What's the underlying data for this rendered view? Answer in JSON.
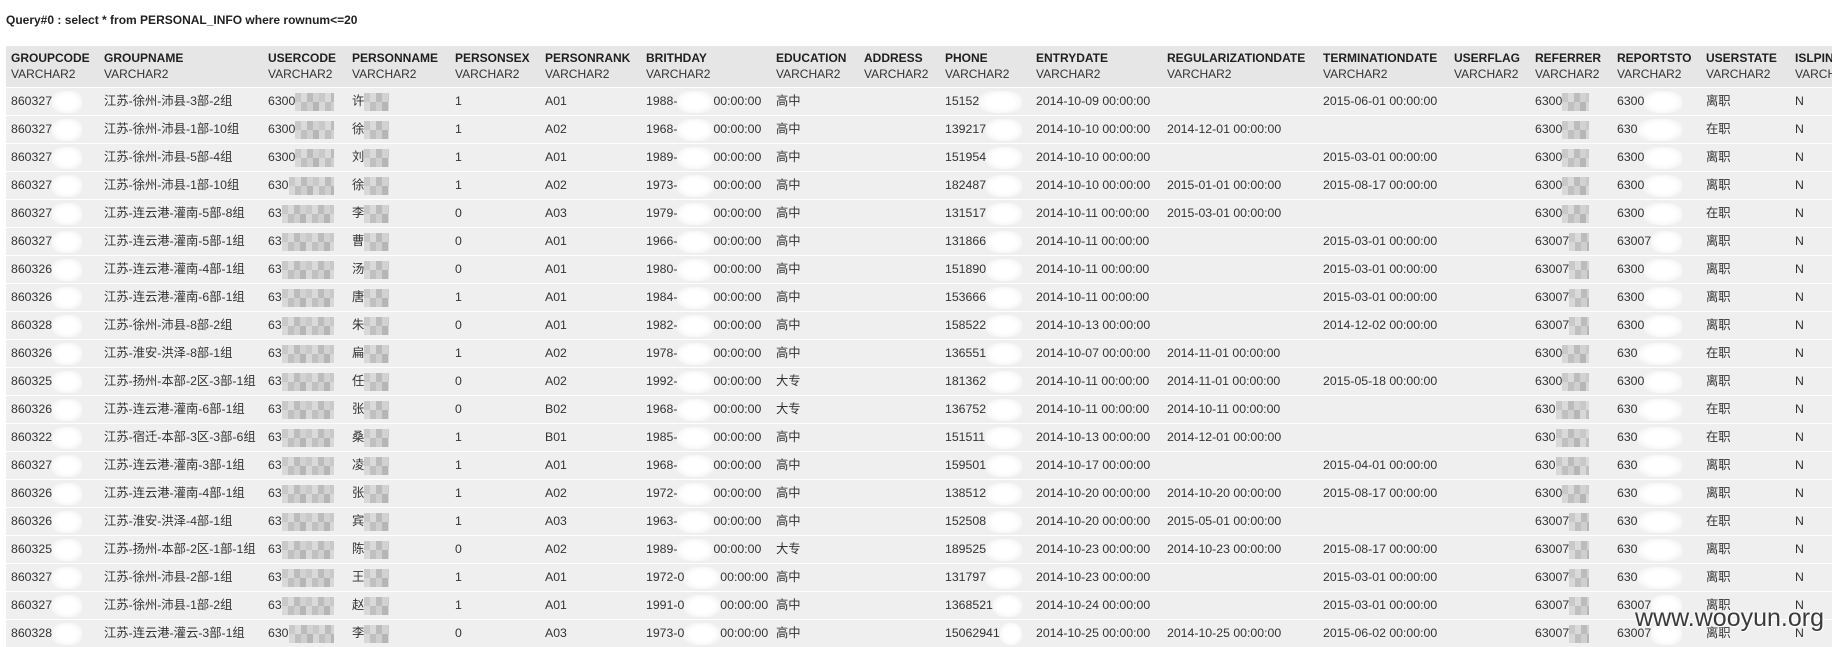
{
  "query": {
    "text": "Query#0 : select * from PERSONAL_INFO where rownum<=20"
  },
  "table": {
    "columns": [
      {
        "name": "GROUPCODE",
        "type": "VARCHAR2"
      },
      {
        "name": "GROUPNAME",
        "type": "VARCHAR2"
      },
      {
        "name": "USERCODE",
        "type": "VARCHAR2"
      },
      {
        "name": "PERSONNAME",
        "type": "VARCHAR2"
      },
      {
        "name": "PERSONSEX",
        "type": "VARCHAR2"
      },
      {
        "name": "PERSONRANK",
        "type": "VARCHAR2"
      },
      {
        "name": "BRITHDAY",
        "type": "VARCHAR2"
      },
      {
        "name": "EDUCATION",
        "type": "VARCHAR2"
      },
      {
        "name": "ADDRESS",
        "type": "VARCHAR2"
      },
      {
        "name": "PHONE",
        "type": "VARCHAR2"
      },
      {
        "name": "ENTRYDATE",
        "type": "VARCHAR2"
      },
      {
        "name": "REGULARIZATIONDATE",
        "type": "VARCHAR2"
      },
      {
        "name": "TERMINATIONDATE",
        "type": "VARCHAR2"
      },
      {
        "name": "USERFLAG",
        "type": "VARCHAR2"
      },
      {
        "name": "REFERRER",
        "type": "VARCHAR2"
      },
      {
        "name": "REPORTSTO",
        "type": "VARCHAR2"
      },
      {
        "name": "USERSTATE",
        "type": "VARCHAR2"
      },
      {
        "name": "ISLPIN",
        "type": "VARCHA"
      }
    ],
    "rows": [
      [
        "860327",
        "江苏-徐州-沛县-3部-2组",
        "6300",
        "许",
        "1",
        "A01",
        [
          "1988-",
          "00:00:00"
        ],
        "高中",
        "",
        "15152",
        "2014-10-09 00:00:00",
        "",
        "2015-06-01 00:00:00",
        "",
        "6300",
        "6300",
        "离职",
        "N"
      ],
      [
        "860327",
        "江苏-徐州-沛县-1部-10组",
        "6300",
        "徐",
        "1",
        "A02",
        [
          "1968-",
          "00:00:00"
        ],
        "高中",
        "",
        "139217",
        "2014-10-10 00:00:00",
        "2014-12-01 00:00:00",
        "",
        "",
        "6300",
        "630",
        "在职",
        "N"
      ],
      [
        "860327",
        "江苏-徐州-沛县-5部-4组",
        "6300",
        "刘",
        "1",
        "A01",
        [
          "1989-",
          "00:00:00"
        ],
        "高中",
        "",
        "151954",
        "2014-10-10 00:00:00",
        "",
        "2015-03-01 00:00:00",
        "",
        "6300",
        "6300",
        "离职",
        "N"
      ],
      [
        "860327",
        "江苏-徐州-沛县-1部-10组",
        "630",
        "徐",
        "1",
        "A02",
        [
          "1973-",
          "00:00:00"
        ],
        "高中",
        "",
        "182487",
        "2014-10-10 00:00:00",
        "2015-01-01 00:00:00",
        "2015-08-17 00:00:00",
        "",
        "6300",
        "6300",
        "离职",
        "N"
      ],
      [
        "860327",
        "江苏-连云港-灌南-5部-8组",
        "63",
        "李",
        "0",
        "A03",
        [
          "1979-",
          "00:00:00"
        ],
        "高中",
        "",
        "131517",
        "2014-10-11 00:00:00",
        "2015-03-01 00:00:00",
        "",
        "",
        "6300",
        "6300",
        "在职",
        "N"
      ],
      [
        "860327",
        "江苏-连云港-灌南-5部-1组",
        "63",
        "曹",
        "0",
        "A01",
        [
          "1966-",
          "00:00:00"
        ],
        "高中",
        "",
        "131866",
        "2014-10-11 00:00:00",
        "",
        "2015-03-01 00:00:00",
        "",
        "63007",
        "63007",
        "离职",
        "N"
      ],
      [
        "860326",
        "江苏-连云港-灌南-4部-1组",
        "63",
        "汤",
        "0",
        "A01",
        [
          "1980-",
          "00:00:00"
        ],
        "高中",
        "",
        "151890",
        "2014-10-11 00:00:00",
        "",
        "2015-03-01 00:00:00",
        "",
        "63007",
        "6300",
        "离职",
        "N"
      ],
      [
        "860326",
        "江苏-连云港-灌南-6部-1组",
        "63",
        "唐",
        "1",
        "A01",
        [
          "1984-",
          "00:00:00"
        ],
        "高中",
        "",
        "153666",
        "2014-10-11 00:00:00",
        "",
        "2015-03-01 00:00:00",
        "",
        "63007",
        "6300",
        "离职",
        "N"
      ],
      [
        "860328",
        "江苏-徐州-沛县-8部-2组",
        "63",
        "朱",
        "0",
        "A01",
        [
          "1982-",
          "00:00:00"
        ],
        "高中",
        "",
        "158522",
        "2014-10-13 00:00:00",
        "",
        "2014-12-02 00:00:00",
        "",
        "63007",
        "6300",
        "离职",
        "N"
      ],
      [
        "860326",
        "江苏-淮安-洪泽-8部-1组",
        "63",
        "扁",
        "1",
        "A02",
        [
          "1978-",
          "00:00:00"
        ],
        "高中",
        "",
        "136551",
        "2014-10-07 00:00:00",
        "2014-11-01 00:00:00",
        "",
        "",
        "6300",
        "630",
        "在职",
        "N"
      ],
      [
        "860325",
        "江苏-扬州-本部-2区-3部-1组",
        "63",
        "任",
        "0",
        "A02",
        [
          "1992-",
          "00:00:00"
        ],
        "大专",
        "",
        "181362",
        "2014-10-11 00:00:00",
        "2014-11-01 00:00:00",
        "2015-05-18 00:00:00",
        "",
        "6300",
        "6300",
        "离职",
        "N"
      ],
      [
        "860326",
        "江苏-连云港-灌南-6部-1组",
        "63",
        "张",
        "0",
        "B02",
        [
          "1968-",
          "00:00:00"
        ],
        "大专",
        "",
        "136752",
        "2014-10-11 00:00:00",
        "2014-10-11 00:00:00",
        "",
        "",
        "630",
        "630",
        "在职",
        "N"
      ],
      [
        "860322",
        "江苏-宿迁-本部-3区-3部-6组",
        "63",
        "桑",
        "1",
        "B01",
        [
          "1985-",
          "00:00:00"
        ],
        "高中",
        "",
        "151511",
        "2014-10-13 00:00:00",
        "2014-12-01 00:00:00",
        "",
        "",
        "630",
        "630",
        "在职",
        "N"
      ],
      [
        "860327",
        "江苏-连云港-灌南-3部-1组",
        "63",
        "凌",
        "1",
        "A01",
        [
          "1968-",
          "00:00:00"
        ],
        "高中",
        "",
        "159501",
        "2014-10-17 00:00:00",
        "",
        "2015-04-01 00:00:00",
        "",
        "630",
        "630",
        "离职",
        "N"
      ],
      [
        "860326",
        "江苏-连云港-灌南-4部-1组",
        "63",
        "张",
        "1",
        "A02",
        [
          "1972-",
          "00:00:00"
        ],
        "高中",
        "",
        "138512",
        "2014-10-20 00:00:00",
        "2014-10-20 00:00:00",
        "2015-08-17 00:00:00",
        "",
        "6300",
        "630",
        "离职",
        "N"
      ],
      [
        "860326",
        "江苏-淮安-洪泽-4部-1组",
        "63",
        "宾",
        "1",
        "A03",
        [
          "1963-",
          "00:00:00"
        ],
        "高中",
        "",
        "152508",
        "2014-10-20 00:00:00",
        "2015-05-01 00:00:00",
        "",
        "",
        "63007",
        "630",
        "在职",
        "N"
      ],
      [
        "860325",
        "江苏-扬州-本部-2区-1部-1组",
        "63",
        "陈",
        "0",
        "A02",
        [
          "1989-",
          "00:00:00"
        ],
        "大专",
        "",
        "189525",
        "2014-10-23 00:00:00",
        "2014-10-23 00:00:00",
        "2015-08-17 00:00:00",
        "",
        "63007",
        "630",
        "离职",
        "N"
      ],
      [
        "860327",
        "江苏-徐州-沛县-2部-1组",
        "63",
        "王",
        "1",
        "A01",
        [
          "1972-0",
          "00:00:00"
        ],
        "高中",
        "",
        "131797",
        "2014-10-23 00:00:00",
        "",
        "2015-03-01 00:00:00",
        "",
        "63007",
        "630",
        "离职",
        "N"
      ],
      [
        "860327",
        "江苏-徐州-沛县-1部-2组",
        "63",
        "赵",
        "1",
        "A01",
        [
          "1991-0",
          "00:00:00"
        ],
        "高中",
        "",
        "1368521",
        "2014-10-24 00:00:00",
        "",
        "2015-03-01 00:00:00",
        "",
        "63007",
        "63007",
        "离职",
        "N"
      ],
      [
        "860328",
        "江苏-连云港-灌云-3部-1组",
        "630",
        "李",
        "0",
        "A03",
        [
          "1973-0",
          "00:00:00"
        ],
        "高中",
        "",
        "15062941",
        "2014-10-25 00:00:00",
        "2014-10-25 00:00:00",
        "2015-06-02 00:00:00",
        "",
        "63007",
        "63007",
        "离职",
        "N"
      ]
    ]
  },
  "watermark": {
    "text": "www.wooyun.org"
  }
}
